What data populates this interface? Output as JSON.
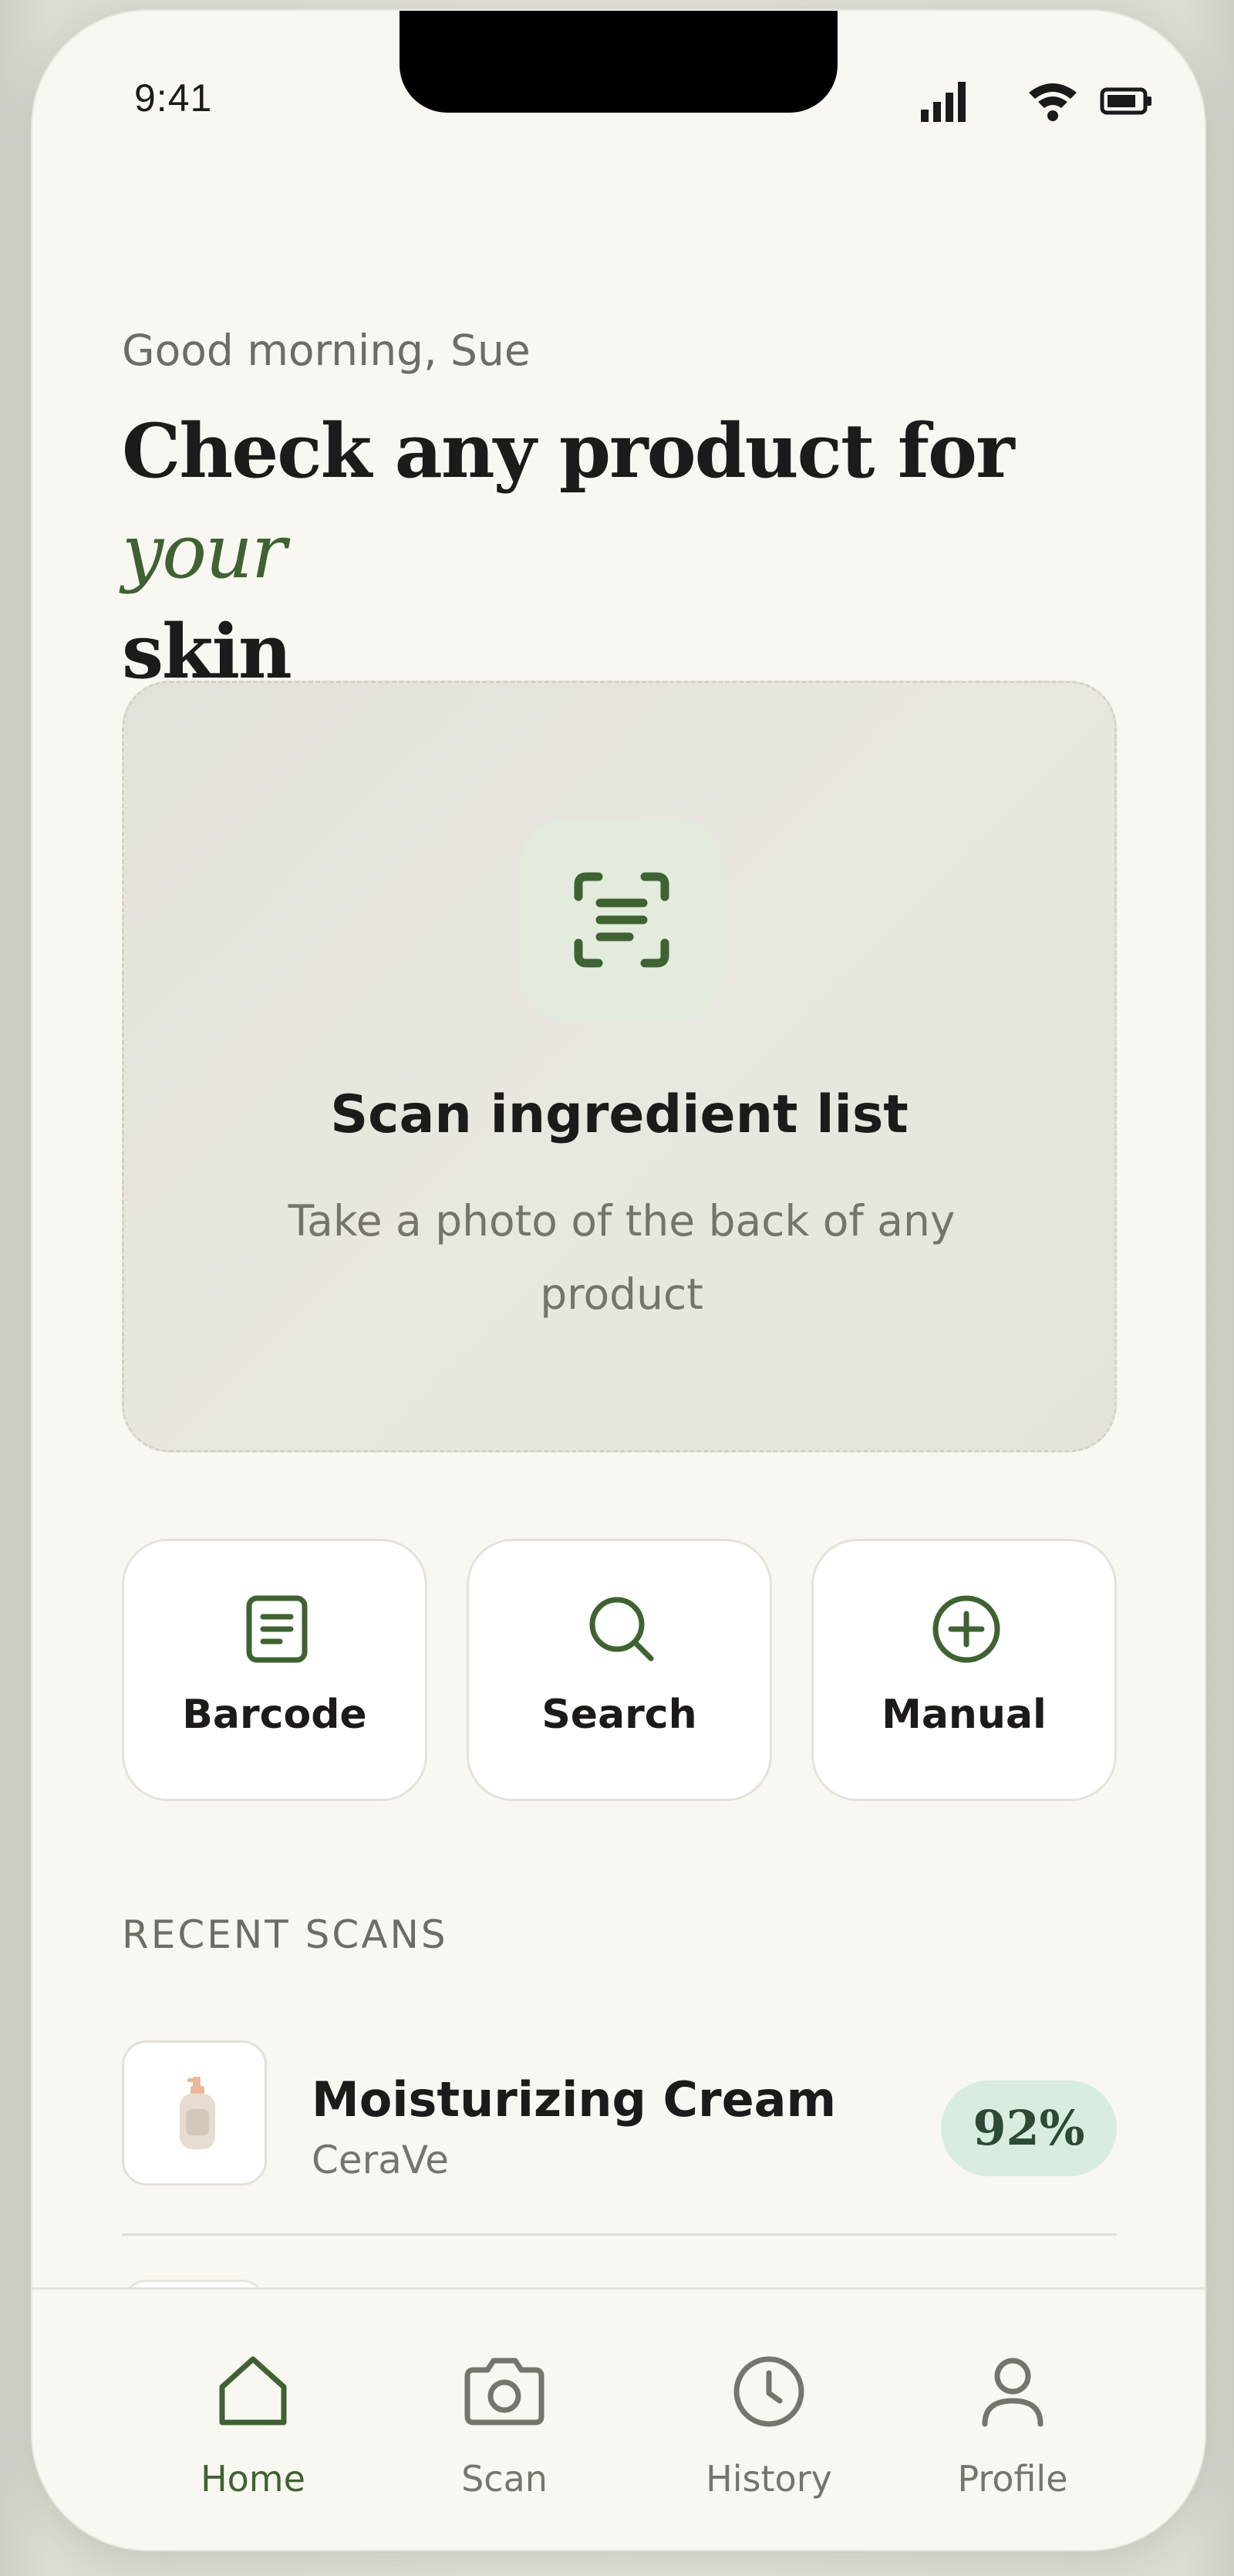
{
  "status_bar": {
    "time": "9:41"
  },
  "greeting": "Good morning, Sue",
  "headline": {
    "line_start": "Check any product for",
    "accent": "your",
    "line_end": "skin"
  },
  "scan_card": {
    "title": "Scan ingredient list",
    "subtitle": "Take a photo of the back of any product",
    "icon": "scan-text-icon"
  },
  "actions": [
    {
      "label": "Barcode",
      "icon": "barcode-document-icon"
    },
    {
      "label": "Search",
      "icon": "search-icon"
    },
    {
      "label": "Manual",
      "icon": "plus-circle-icon"
    }
  ],
  "recent_scans": {
    "title": "RECENT SCANS",
    "items": [
      {
        "name": "Moisturizing Cream",
        "brand": "CeraVe",
        "score": "92%",
        "icon": "pump-bottle-icon"
      }
    ]
  },
  "tabbar": {
    "items": [
      {
        "label": "Home",
        "icon": "home-icon",
        "active": true
      },
      {
        "label": "Scan",
        "icon": "camera-icon",
        "active": false
      },
      {
        "label": "History",
        "icon": "clock-icon",
        "active": false
      },
      {
        "label": "Profile",
        "icon": "user-icon",
        "active": false
      }
    ]
  },
  "colors": {
    "accent_green": "#3f6232",
    "background": "#f9f7f2",
    "score_badge_bg": "#d8eddf",
    "text_primary": "#1c1b19",
    "text_secondary": "#77746e"
  }
}
